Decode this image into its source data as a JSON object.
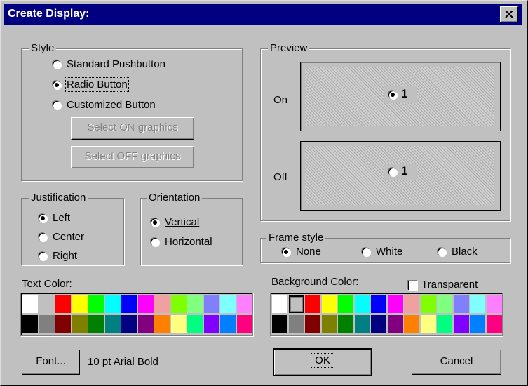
{
  "window": {
    "title": "Create Display:",
    "close_icon": "close-x-icon"
  },
  "style_group": {
    "legend": "Style",
    "options": [
      "Standard Pushbutton",
      "Radio Button",
      "Customized Button"
    ],
    "selected": "Radio Button",
    "select_on_label": "Select ON graphics",
    "select_off_label": "Select OFF graphics"
  },
  "preview": {
    "legend": "Preview",
    "on_label": "On",
    "off_label": "Off",
    "item_text_on": "1",
    "item_text_off": "1"
  },
  "justification": {
    "legend": "Justification",
    "options": [
      "Left",
      "Center",
      "Right"
    ],
    "selected": "Left"
  },
  "orientation": {
    "legend": "Orientation",
    "options": [
      "Vertical",
      "Horizontal"
    ],
    "selected": "Vertical"
  },
  "frame_style": {
    "legend": "Frame style",
    "options": [
      "None",
      "White",
      "Black"
    ],
    "selected": "None"
  },
  "text_color": {
    "label": "Text Color:",
    "selected_index": null,
    "colors": [
      "#ffffff",
      "#c0c0c0",
      "#ff0000",
      "#ffff00",
      "#00ff00",
      "#00ffff",
      "#0000ff",
      "#ff00ff",
      "#f0a0a0",
      "#80ff00",
      "#80ff80",
      "#8080ff",
      "#80ffff",
      "#ff80ff",
      "#000000",
      "#808080",
      "#800000",
      "#808000",
      "#008000",
      "#008080",
      "#000080",
      "#800080",
      "#ff8000",
      "#ffff80",
      "#00ff80",
      "#8000ff",
      "#0080ff",
      "#ff0080"
    ]
  },
  "background_color": {
    "label": "Background Color:",
    "selected_index": 1,
    "transparent_label": "Transparent",
    "transparent_checked": false,
    "colors": [
      "#ffffff",
      "#c0c0c0",
      "#ff0000",
      "#ffff00",
      "#00ff00",
      "#00ffff",
      "#0000ff",
      "#ff00ff",
      "#f0a0a0",
      "#80ff00",
      "#80ff80",
      "#8080ff",
      "#80ffff",
      "#ff80ff",
      "#000000",
      "#808080",
      "#800000",
      "#808000",
      "#008000",
      "#008080",
      "#000080",
      "#800080",
      "#ff8000",
      "#ffff80",
      "#00ff80",
      "#8000ff",
      "#0080ff",
      "#ff0080"
    ]
  },
  "footer": {
    "font_button": "Font...",
    "font_desc": "10 pt Arial Bold",
    "ok_label": "OK",
    "cancel_label": "Cancel"
  }
}
